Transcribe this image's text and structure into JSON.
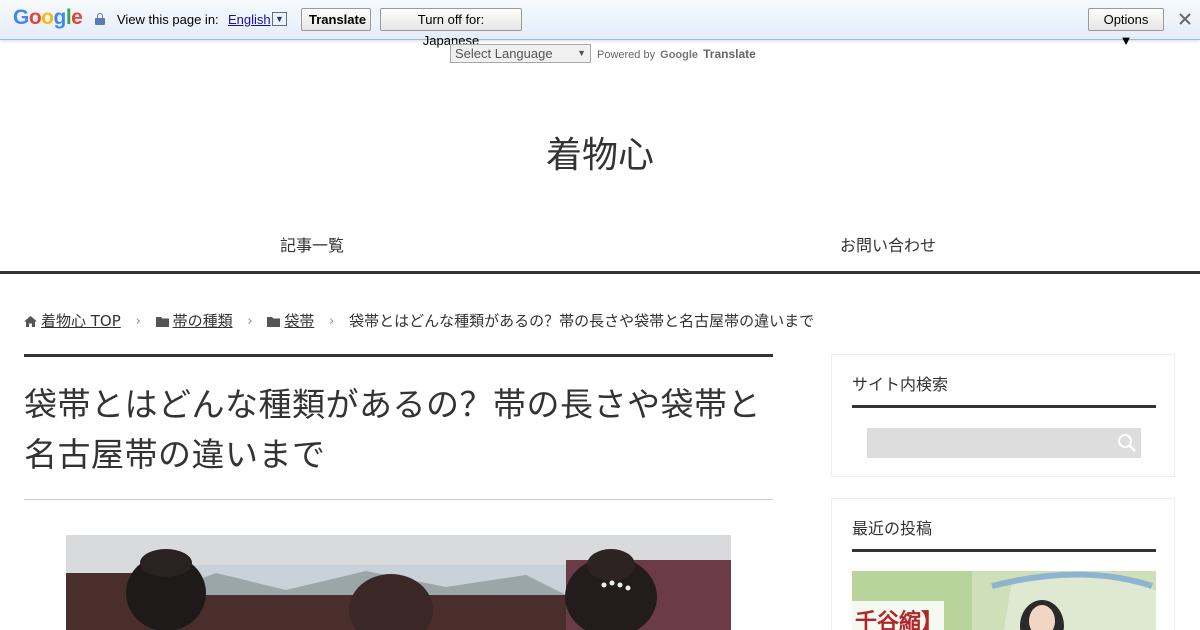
{
  "translate_bar": {
    "logo": "Google",
    "view_label": "View this page in:",
    "language": "English",
    "translate_button": "Translate",
    "turn_off_button": "Turn off for: Japanese",
    "options_button": "Options ▼"
  },
  "language_widget": {
    "select_label": "Select Language",
    "powered_by": "Powered by",
    "powered_google": "Google",
    "powered_translate": "Translate"
  },
  "site": {
    "title": "着物心"
  },
  "nav": {
    "items": [
      {
        "label": "記事一覧"
      },
      {
        "label": "お問い合わせ"
      }
    ]
  },
  "breadcrumb": {
    "home": "着物心 TOP",
    "cat1": "帯の種類",
    "cat2": "袋帯",
    "current": "袋帯とはどんな種類があるの？帯の長さや袋帯と名古屋帯の違いまで"
  },
  "article": {
    "title": "袋帯とはどんな種類があるの？帯の長さや袋帯と名古屋帯の違いまで"
  },
  "sidebar": {
    "search_heading": "サイト内検索",
    "search_placeholder": "",
    "recent_heading": "最近の投稿",
    "recent_thumb_text": "千谷縮】"
  },
  "colors": {
    "text": "#333333",
    "link": "#1a0dab",
    "bar_bg": "#e3edf9",
    "rule": "#333333"
  }
}
